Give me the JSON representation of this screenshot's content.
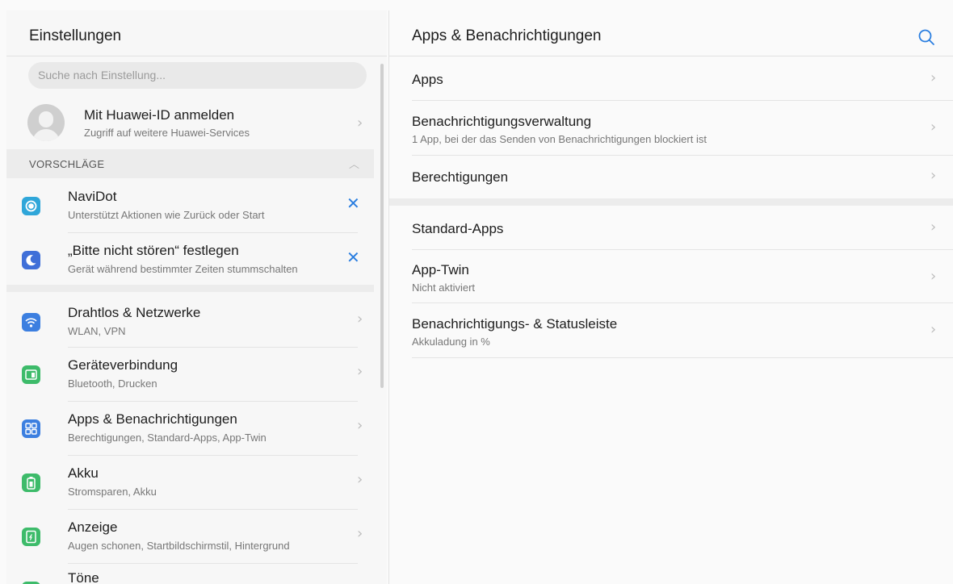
{
  "left": {
    "title": "Einstellungen",
    "search_placeholder": "Suche nach Einstellung...",
    "profile": {
      "title": "Mit Huawei-ID anmelden",
      "subtitle": "Zugriff auf weitere Huawei-Services"
    },
    "section_label": "VORSCHLÄGE",
    "suggestions": [
      {
        "title": "NaviDot",
        "subtitle": "Unterstützt Aktionen wie Zurück oder Start",
        "icon": "navidot-icon",
        "color": "#2fa6d9"
      },
      {
        "title": "„Bitte nicht stören“ festlegen",
        "subtitle": "Gerät während bestimmter Zeiten stummschalten",
        "icon": "moon-icon",
        "color": "#3f6fd8"
      }
    ],
    "items": [
      {
        "title": "Drahtlos & Netzwerke",
        "subtitle": "WLAN, VPN",
        "icon": "wifi-icon",
        "color": "#3c7fe0"
      },
      {
        "title": "Geräteverbindung",
        "subtitle": "Bluetooth, Drucken",
        "icon": "device-connection-icon",
        "color": "#3dbb6a"
      },
      {
        "title": "Apps & Benachrichtigungen",
        "subtitle": "Berechtigungen, Standard-Apps, App-Twin",
        "icon": "apps-grid-icon",
        "color": "#3c7fe0"
      },
      {
        "title": "Akku",
        "subtitle": "Stromsparen, Akku",
        "icon": "battery-icon",
        "color": "#3dbb6a"
      },
      {
        "title": "Anzeige",
        "subtitle": "Augen schonen, Startbildschirmstil, Hintergrund",
        "icon": "display-icon",
        "color": "#3dbb6a"
      },
      {
        "title": "Töne",
        "subtitle": "",
        "icon": "sound-icon",
        "color": "#3dbb6a"
      }
    ]
  },
  "right": {
    "title": "Apps & Benachrichtigungen",
    "group1": [
      {
        "title": "Apps",
        "subtitle": ""
      },
      {
        "title": "Benachrichtigungsverwaltung",
        "subtitle": "1 App, bei der das Senden von Benachrichtigungen blockiert ist"
      },
      {
        "title": "Berechtigungen",
        "subtitle": ""
      }
    ],
    "group2": [
      {
        "title": "Standard-Apps",
        "subtitle": ""
      },
      {
        "title": "App-Twin",
        "subtitle": "Nicht aktiviert"
      },
      {
        "title": "Benachrichtigungs- & Statusleiste",
        "subtitle": "Akkuladung in %"
      }
    ]
  },
  "colors": {
    "accent": "#2a7ee0",
    "chevron": "#bdbdbd"
  }
}
